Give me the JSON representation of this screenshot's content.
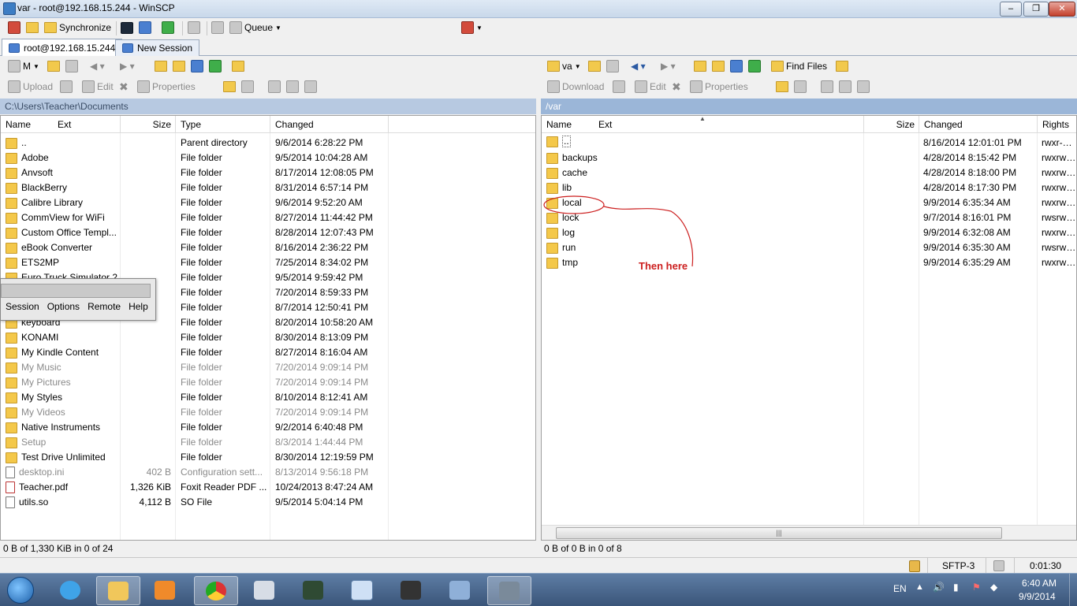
{
  "window": {
    "title": "var - root@192.168.15.244 - WinSCP"
  },
  "toolbar_main": {
    "synchronize": "Synchronize",
    "queue": "Queue"
  },
  "tabs": [
    {
      "label": "root@192.168.15.244"
    },
    {
      "label": "New Session"
    }
  ],
  "left_panel": {
    "drive": "M",
    "toolbar2": {
      "upload": "Upload",
      "edit": "Edit",
      "properties": "Properties"
    },
    "path": "C:\\Users\\Teacher\\Documents",
    "columns": {
      "name": "Name",
      "ext": "Ext",
      "size": "Size",
      "type": "Type",
      "changed": "Changed"
    },
    "rows": [
      {
        "name": "..",
        "size": "",
        "type": "Parent directory",
        "changed": "9/6/2014  6:28:22 PM",
        "icon": "up",
        "dim": false
      },
      {
        "name": "Adobe",
        "size": "",
        "type": "File folder",
        "changed": "9/5/2014  10:04:28 AM",
        "icon": "folder",
        "dim": false
      },
      {
        "name": "Anvsoft",
        "size": "",
        "type": "File folder",
        "changed": "8/17/2014  12:08:05 PM",
        "icon": "folder",
        "dim": false
      },
      {
        "name": "BlackBerry",
        "size": "",
        "type": "File folder",
        "changed": "8/31/2014  6:57:14 PM",
        "icon": "folder",
        "dim": false
      },
      {
        "name": "Calibre Library",
        "size": "",
        "type": "File folder",
        "changed": "9/6/2014  9:52:20 AM",
        "icon": "folder",
        "dim": false
      },
      {
        "name": "CommView for WiFi",
        "size": "",
        "type": "File folder",
        "changed": "8/27/2014  11:44:42 PM",
        "icon": "folder",
        "dim": false
      },
      {
        "name": "Custom Office Templ...",
        "size": "",
        "type": "File folder",
        "changed": "8/28/2014  12:07:43 PM",
        "icon": "folder",
        "dim": false
      },
      {
        "name": "eBook Converter",
        "size": "",
        "type": "File folder",
        "changed": "8/16/2014  2:36:22 PM",
        "icon": "folder",
        "dim": false
      },
      {
        "name": "ETS2MP",
        "size": "",
        "type": "File folder",
        "changed": "7/25/2014  8:34:02 PM",
        "icon": "folder",
        "dim": false
      },
      {
        "name": "Euro Truck Simulator 2",
        "size": "",
        "type": "File folder",
        "changed": "9/5/2014  9:59:42 PM",
        "icon": "folder",
        "dim": false
      },
      {
        "name": "",
        "size": "",
        "type": "File folder",
        "changed": "7/20/2014  8:59:33 PM",
        "icon": "folder",
        "dim": false
      },
      {
        "name": "",
        "size": "",
        "type": "File folder",
        "changed": "8/7/2014  12:50:41 PM",
        "icon": "folder",
        "dim": false
      },
      {
        "name": "keyboard",
        "size": "",
        "type": "File folder",
        "changed": "8/20/2014  10:58:20 AM",
        "icon": "folder",
        "dim": false
      },
      {
        "name": "KONAMI",
        "size": "",
        "type": "File folder",
        "changed": "8/30/2014  8:13:09 PM",
        "icon": "folder",
        "dim": false
      },
      {
        "name": "My Kindle Content",
        "size": "",
        "type": "File folder",
        "changed": "8/27/2014  8:16:04 AM",
        "icon": "folder",
        "dim": false
      },
      {
        "name": "My Music",
        "size": "",
        "type": "File folder",
        "changed": "7/20/2014  9:09:14 PM",
        "icon": "folder",
        "dim": true
      },
      {
        "name": "My Pictures",
        "size": "",
        "type": "File folder",
        "changed": "7/20/2014  9:09:14 PM",
        "icon": "folder",
        "dim": true
      },
      {
        "name": "My Styles",
        "size": "",
        "type": "File folder",
        "changed": "8/10/2014  8:12:41 AM",
        "icon": "folder",
        "dim": false
      },
      {
        "name": "My Videos",
        "size": "",
        "type": "File folder",
        "changed": "7/20/2014  9:09:14 PM",
        "icon": "folder",
        "dim": true
      },
      {
        "name": "Native Instruments",
        "size": "",
        "type": "File folder",
        "changed": "9/2/2014  6:40:48 PM",
        "icon": "folder",
        "dim": false
      },
      {
        "name": "Setup",
        "size": "",
        "type": "File folder",
        "changed": "8/3/2014  1:44:44 PM",
        "icon": "folder",
        "dim": true
      },
      {
        "name": "Test Drive Unlimited",
        "size": "",
        "type": "File folder",
        "changed": "8/30/2014  12:19:59 PM",
        "icon": "folder",
        "dim": false
      },
      {
        "name": "desktop.ini",
        "size": "402 B",
        "type": "Configuration sett...",
        "changed": "8/13/2014  9:56:18 PM",
        "icon": "file",
        "dim": true
      },
      {
        "name": "Teacher.pdf",
        "size": "1,326 KiB",
        "type": "Foxit Reader PDF ...",
        "changed": "10/24/2013  8:47:24 AM",
        "icon": "pdf",
        "dim": false
      },
      {
        "name": "utils.so",
        "size": "4,112 B",
        "type": "SO File",
        "changed": "9/5/2014  5:04:14 PM",
        "icon": "file",
        "dim": false
      }
    ],
    "status": "0 B of 1,330 KiB in 0 of 24"
  },
  "menu_popup": {
    "items": [
      "Session",
      "Options",
      "Remote",
      "Help"
    ]
  },
  "right_panel": {
    "drive": "va",
    "find_files": "Find Files",
    "toolbar2": {
      "download": "Download",
      "edit": "Edit",
      "properties": "Properties"
    },
    "path": "/var",
    "columns": {
      "name": "Name",
      "ext": "Ext",
      "size": "Size",
      "changed": "Changed",
      "rights": "Rights"
    },
    "rows": [
      {
        "name": "..",
        "changed": "8/16/2014  12:01:01 PM",
        "rights": "rwxr-xr-x",
        "icon": "up"
      },
      {
        "name": "backups",
        "changed": "4/28/2014  8:15:42 PM",
        "rights": "rwxrwxr-x",
        "icon": "folder"
      },
      {
        "name": "cache",
        "changed": "4/28/2014  8:18:00 PM",
        "rights": "rwxrwxr-x",
        "icon": "folder"
      },
      {
        "name": "lib",
        "changed": "4/28/2014  8:17:30 PM",
        "rights": "rwxrwxr-x",
        "icon": "folder"
      },
      {
        "name": "local",
        "changed": "9/9/2014  6:35:34 AM",
        "rights": "rwxrwxr-x",
        "icon": "folder"
      },
      {
        "name": "lock",
        "changed": "9/7/2014  8:16:01 PM",
        "rights": "rwsrwsrwt",
        "icon": "folder"
      },
      {
        "name": "log",
        "changed": "9/9/2014  6:32:08 AM",
        "rights": "rwxrwxr-x",
        "icon": "folder"
      },
      {
        "name": "run",
        "changed": "9/9/2014  6:35:30 AM",
        "rights": "rwsrwsrwt",
        "icon": "folder"
      },
      {
        "name": "tmp",
        "changed": "9/9/2014  6:35:29 AM",
        "rights": "rwxrwxrwt",
        "icon": "folder"
      }
    ],
    "status": "0 B of 0 B in 0 of 8"
  },
  "annotation": {
    "text": "Then here",
    "color": "#cc1f1f"
  },
  "status_bar": {
    "protocol": "SFTP-3",
    "elapsed": "0:01:30"
  },
  "taskbar": {
    "apps": [
      "start-orb",
      "internet-explorer",
      "file-explorer",
      "media-player",
      "chrome",
      "calculator",
      "terminal-app",
      "window-app",
      "game-app",
      "keyboard-app",
      "winscp"
    ],
    "language": "EN",
    "time": "6:40 AM",
    "date": "9/9/2014"
  }
}
